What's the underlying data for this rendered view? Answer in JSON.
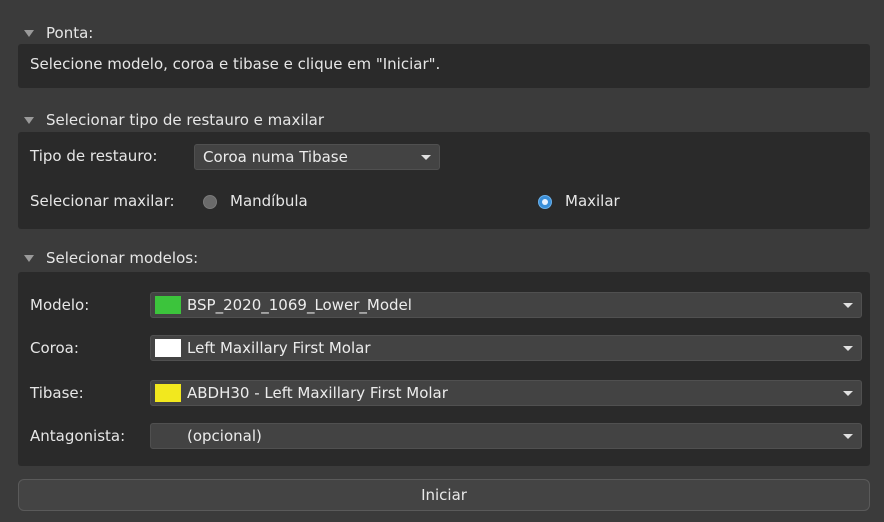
{
  "sections": {
    "tip": {
      "title": "Ponta:",
      "message": "Selecione modelo, coroa e tibase e clique em \"Iniciar\"."
    },
    "restoration": {
      "title": "Selecionar tipo de restauro e maxilar",
      "type_label": "Tipo de restauro:",
      "type_value": "Coroa numa Tibase",
      "jaw_label": "Selecionar maxilar:",
      "jaw_options": [
        {
          "label": "Mandíbula",
          "selected": false
        },
        {
          "label": "Maxilar",
          "selected": true
        }
      ]
    },
    "models": {
      "title": "Selecionar modelos:",
      "rows": [
        {
          "label": "Modelo:",
          "value": "BSP_2020_1069_Lower_Model",
          "swatch": "#3cc43c"
        },
        {
          "label": "Coroa:",
          "value": "Left Maxillary First Molar",
          "swatch": "#ffffff"
        },
        {
          "label": "Tibase:",
          "value": "ABDH30 - Left Maxillary First Molar",
          "swatch": "#f2e81e"
        },
        {
          "label": "Antagonista:",
          "value": "(opcional)",
          "swatch": ""
        }
      ]
    }
  },
  "start_button": "Iniciar",
  "icons": {
    "section_toggle": "triangle-down-icon",
    "dropdown": "chevron-down-icon"
  }
}
